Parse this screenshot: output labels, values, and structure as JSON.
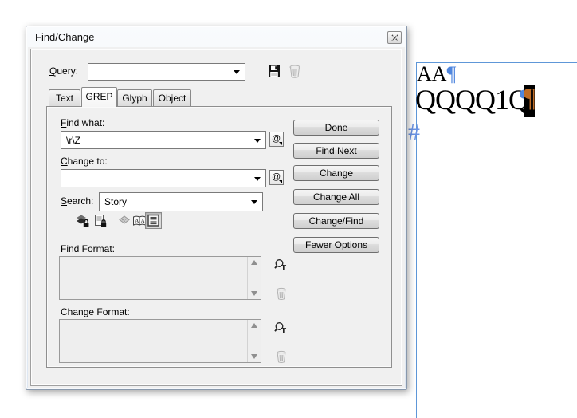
{
  "window": {
    "title": "Find/Change"
  },
  "query": {
    "label_mnemonic": "Q",
    "label_rest": "uery:",
    "value": "",
    "save_icon": "save-query-icon",
    "delete_icon": "delete-query-icon"
  },
  "tabs": [
    {
      "label": "Text",
      "active": false
    },
    {
      "label": "GREP",
      "active": true
    },
    {
      "label": "Glyph",
      "active": false
    },
    {
      "label": "Object",
      "active": false
    }
  ],
  "fields": {
    "find_what": {
      "label_mnemonic": "F",
      "label_rest": "ind what:",
      "value": "\\r\\Z",
      "at_symbol": "@"
    },
    "change_to": {
      "label_mnemonic": "C",
      "label_rest": "hange to:",
      "value": "",
      "at_symbol": "@"
    },
    "search": {
      "label_mnemonic": "S",
      "label_rest": "earch:",
      "value": "Story"
    }
  },
  "search_toggles": [
    {
      "name": "include-locked-layers-icon",
      "active": false
    },
    {
      "name": "include-locked-stories-icon",
      "active": false
    },
    {
      "name": "include-hidden-layers-icon",
      "active": false
    },
    {
      "name": "include-master-pages-icon",
      "active": false
    },
    {
      "name": "include-footnotes-icon",
      "active": true
    }
  ],
  "buttons": {
    "done": "Done",
    "find_next": "Find Next",
    "change": "Change",
    "change_all": "Change All",
    "change_find": "Change/Find",
    "fewer_options": "Fewer Options"
  },
  "formats": {
    "find_label": "Find Format:",
    "change_label": "Change Format:",
    "specify_icon": "specify-attributes-icon",
    "clear_icon": "clear-attributes-icon"
  },
  "document": {
    "line1_text": "AA",
    "line1_mark": "¶",
    "line2_text": "QQQQ1Q",
    "hidden_mark_behind": "¶",
    "selected_mark": "¶",
    "end_of_story_marker": "#"
  },
  "colors": {
    "frame_blue": "#5e97d8",
    "hidden_char_blue": "#4f86de",
    "end_marker_blue": "#6b93e4",
    "selection_highlight": "#000000",
    "selected_mark_orange": "#bf6c26",
    "dialog_background": "#f0f0f0"
  }
}
